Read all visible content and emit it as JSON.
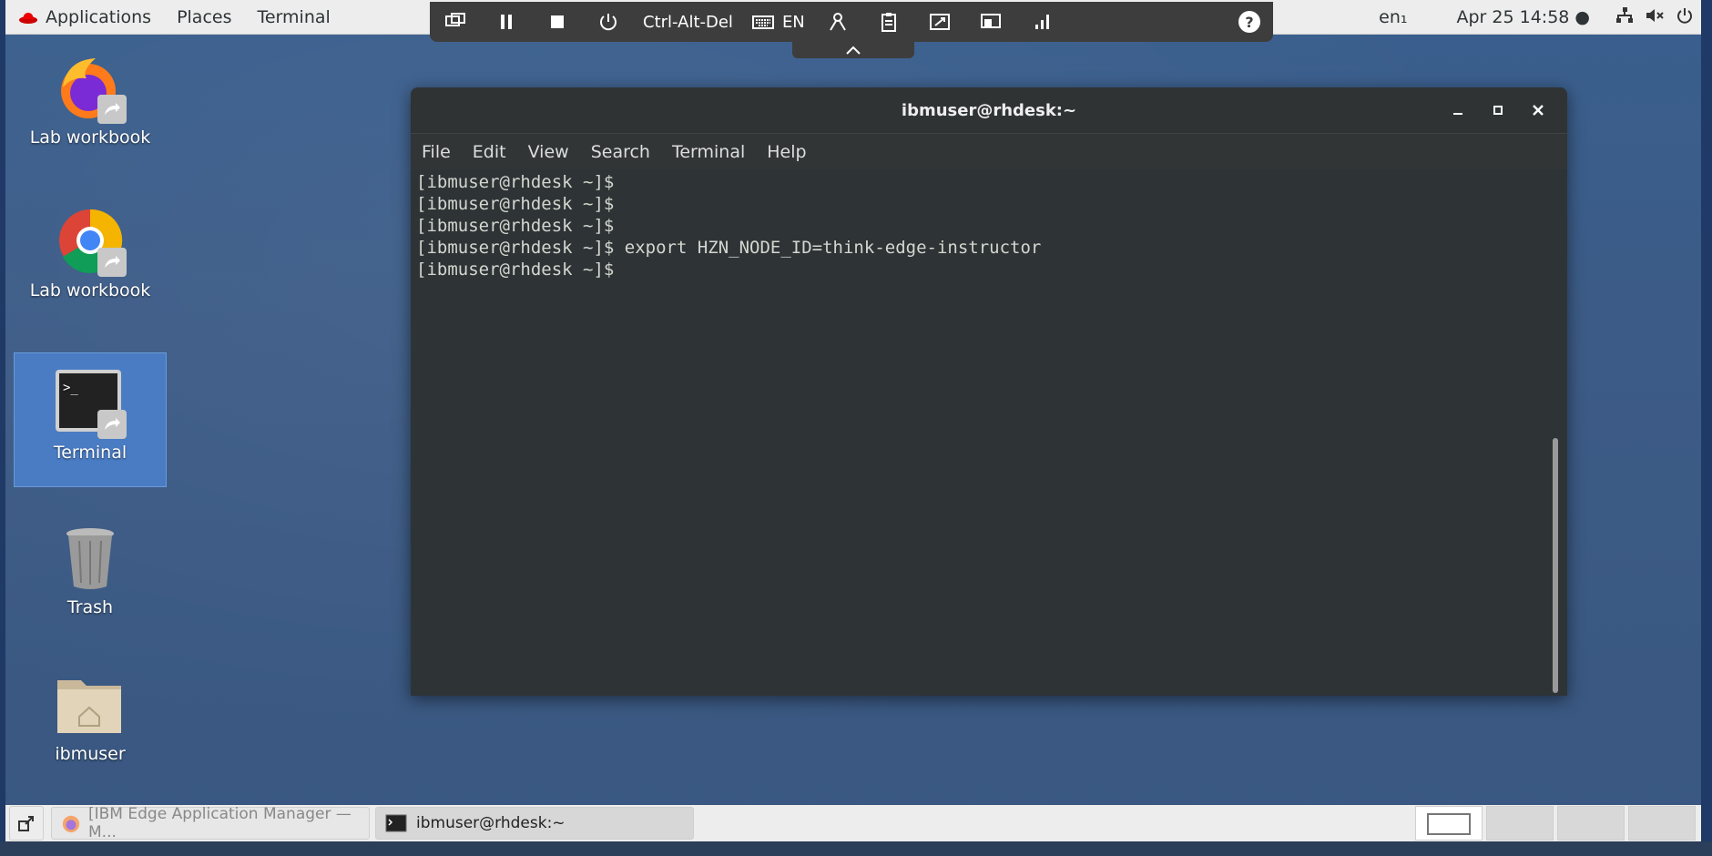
{
  "top_panel": {
    "applications": "Applications",
    "places": "Places",
    "terminal": "Terminal",
    "keyboard_layout": "en₁",
    "datetime": "Apr 25  14:58 ●"
  },
  "remote_toolbar": {
    "ctrl_alt_del": "Ctrl-Alt-Del",
    "language": "EN",
    "help": "?"
  },
  "desktop_icons": [
    {
      "label": "Lab workbook"
    },
    {
      "label": "Lab workbook"
    },
    {
      "label": "Terminal"
    },
    {
      "label": "Trash"
    },
    {
      "label": "ibmuser"
    }
  ],
  "terminal_window": {
    "title": "ibmuser@rhdesk:~",
    "menu": [
      "File",
      "Edit",
      "View",
      "Search",
      "Terminal",
      "Help"
    ],
    "lines": [
      "[ibmuser@rhdesk ~]$",
      "[ibmuser@rhdesk ~]$",
      "[ibmuser@rhdesk ~]$",
      "[ibmuser@rhdesk ~]$ export HZN_NODE_ID=think-edge-instructor",
      "[ibmuser@rhdesk ~]$ "
    ]
  },
  "taskbar": {
    "items": [
      {
        "label": "[IBM Edge Application Manager — M..."
      },
      {
        "label": "ibmuser@rhdesk:~"
      }
    ]
  },
  "colors": {
    "desktop_bg": "#3a5f8e",
    "panel_bg": "#ededed",
    "toolbar_bg": "#3d3d3d",
    "terminal_bg": "#2e3436",
    "selection": "#4a7cc4"
  }
}
